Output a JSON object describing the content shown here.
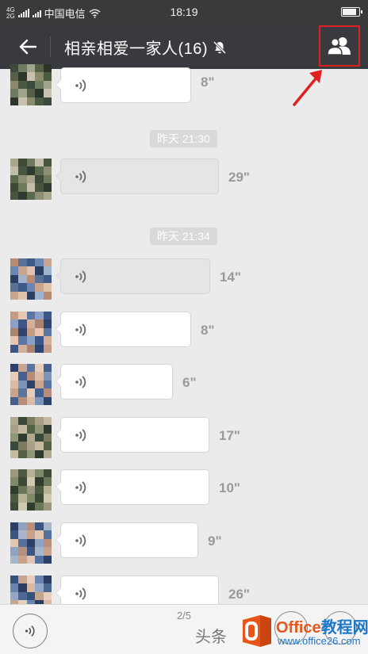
{
  "status_bar": {
    "network_type_top": "4G",
    "network_type_bottom": "2G",
    "carrier": "中国电信",
    "time": "18:19",
    "battery_level": 0.75
  },
  "header": {
    "title": "相亲相爱一家人(16)",
    "muted": true,
    "back_icon": "back-arrow-icon",
    "members_icon": "group-members-icon",
    "highlight_color": "#e02020"
  },
  "timestamps": [
    "昨天 21:30",
    "昨天 21:34"
  ],
  "messages": [
    {
      "duration": "8\"",
      "read": false
    },
    {
      "duration": "29\"",
      "read": true
    },
    {
      "duration": "14\"",
      "read": true
    },
    {
      "duration": "8\"",
      "read": false
    },
    {
      "duration": "6\"",
      "read": false
    },
    {
      "duration": "17\"",
      "read": false
    },
    {
      "duration": "10\"",
      "read": false
    },
    {
      "duration": "9\"",
      "read": false
    },
    {
      "duration": "26\"",
      "read": false
    }
  ],
  "bottom_bar": {
    "page_indicator": "2/5",
    "voice_icon": "voice-mode-icon",
    "emoji_icon": "emoji-icon",
    "plus_icon": "plus-icon",
    "source_text": "头条"
  },
  "watermark": {
    "brand_prefix": "Office",
    "brand_suffix": "教程网",
    "url": "www.office26.com"
  },
  "colors": {
    "header_bg": "#393a3f",
    "chat_bg": "#ebebeb",
    "bubble_bg": "#ffffff",
    "read_bubble_bg": "#e5e5e5",
    "watermark_blue": "#1e78c8",
    "watermark_orange": "#e8561b"
  }
}
